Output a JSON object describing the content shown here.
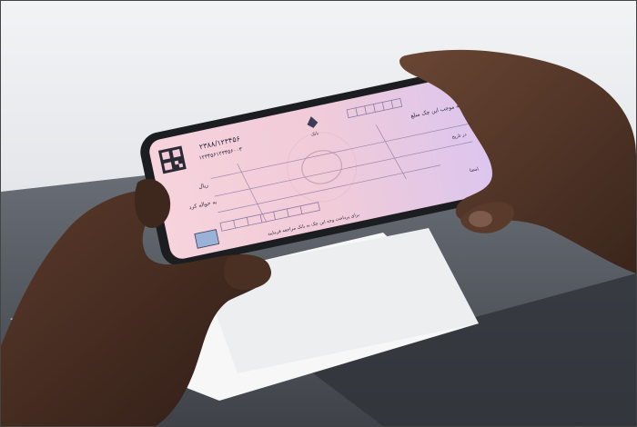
{
  "photo": {
    "caption": "",
    "colors": {
      "background": "#e7e8ea",
      "laptop": "#5a5f66",
      "skin": "#4a3024",
      "phone_body": "#202226",
      "cheque_pink": "#f3c9d6",
      "cheque_lilac": "#d9c3ea"
    }
  },
  "cheque": {
    "serial_number": "۲۳۸۸/۱۲۳۴۵۶",
    "account_number": "۱۲۳۴۵۶۱۲۳۴۵۶۰۰۳",
    "bank_label": "بانک",
    "pay_to_label": "به موجب این چک مبلغ",
    "currency_label": "ریال",
    "order_label": "به حواله کرد",
    "date_label": "در تاریخ",
    "signature_label": "امضا",
    "footer_note": "برای پرداخت وجه این چک به بانک مراجعه فرمایید"
  }
}
